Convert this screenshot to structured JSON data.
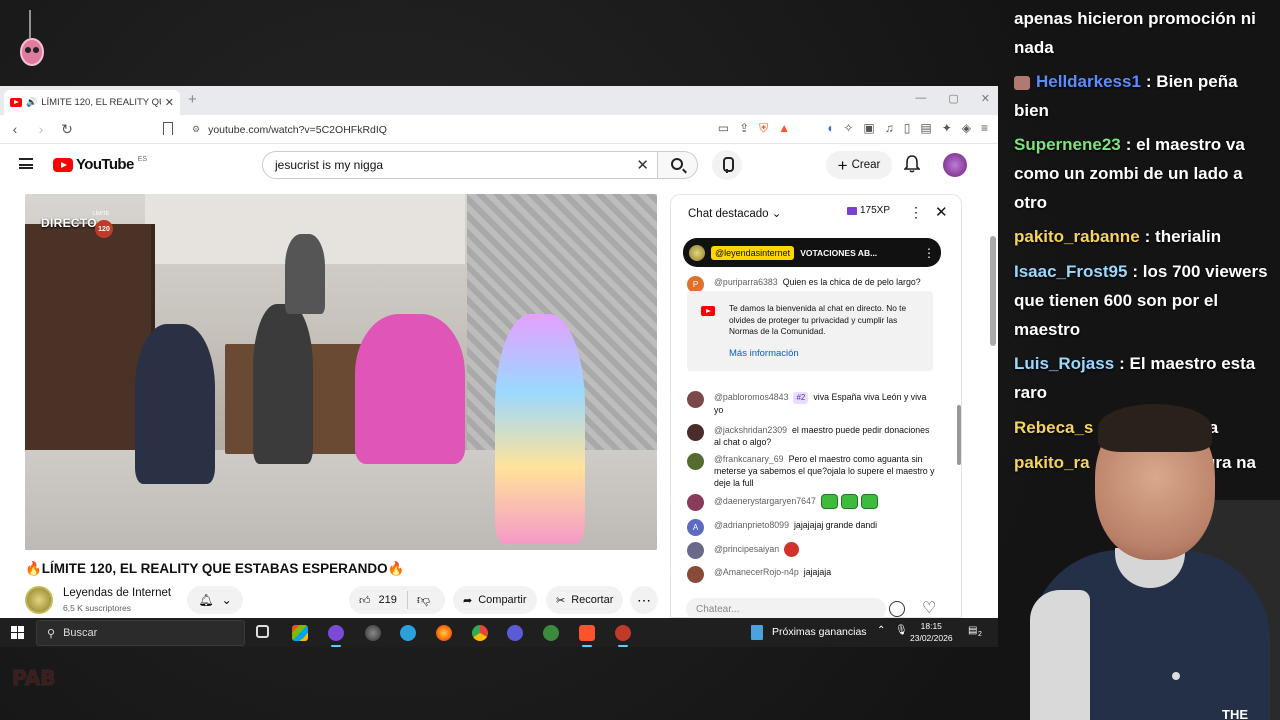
{
  "browser": {
    "tab_title": "LÍMITE 120, EL REALITY QU",
    "new_tab_symbol": "+",
    "window_controls": [
      "—",
      "▢",
      "✕"
    ],
    "url": "youtube.com/watch?v=5C2OHFkRdIQ"
  },
  "youtube": {
    "logo_word": "YouTube",
    "logo_region": "ES",
    "search_value": "jesucrist is my nigga",
    "create_label": "Crear",
    "video": {
      "live_label": "DIRECTO",
      "limite_label": "LÍMITE",
      "limite_number": "120",
      "title": "🔥LÍMITE 120, EL REALITY QUE ESTABAS ESPERANDO🔥",
      "channel_name": "Leyendas de Internet",
      "subscribers": "6,5 K suscriptores",
      "likes": "219",
      "share_label": "Compartir",
      "clip_label": "Recortar"
    },
    "chat": {
      "header": "Chat destacado",
      "xp": "175XP",
      "pinned_user": "@leyendasinternet",
      "pinned_text": "VOTACIONES AB...",
      "welcome_text": "Te damos la bienvenida al chat en directo. No te olvides de proteger tu privacidad y cumplir las Normas de la Comunidad.",
      "welcome_link": "Más información",
      "input_placeholder": "Chatear...",
      "messages": [
        {
          "user": "@puriparra6383",
          "text": "Quien es la chica de de pelo largo?",
          "initial": "P",
          "color": "#e0702b"
        },
        {
          "user": "@pabloromos4843",
          "badge": "#2",
          "text": "viva España viva León y viva yo",
          "initial": "",
          "color": "#7a4a4a"
        },
        {
          "user": "@jackshridan2309",
          "text": "el maestro puede pedir donaciones al chat o algo?",
          "initial": "",
          "color": "#4a2c2c"
        },
        {
          "user": "@frankcanary_69",
          "text": "Pero el maestro como aguanta sin meterse ya sabemos el que?ojala lo supere el maestro y deje la full",
          "initial": "",
          "color": "#556b2f"
        },
        {
          "user": "@daenerystargaryen7647",
          "text": "",
          "initial": "",
          "color": "#8a3a5a"
        },
        {
          "user": "@adrianprieto8099",
          "text": "jajajajaj grande dandi",
          "initial": "A",
          "color": "#5c6bc0"
        },
        {
          "user": "@principesaiyan",
          "text": "",
          "initial": "",
          "color": "#6a6a8a"
        },
        {
          "user": "@AmanecerRojo-n4p",
          "text": "jajajaja",
          "initial": "",
          "color": "#8a4a3a"
        }
      ]
    }
  },
  "taskbar": {
    "search_label": "Buscar",
    "tray_label": "Próximas ganancias",
    "time": "18:15",
    "date": "23/02/2026",
    "notification_count": "2"
  },
  "stream_chat": [
    {
      "name": "",
      "text": "apenas hicieron promoción ni nada",
      "color": "#ffffff"
    },
    {
      "name": "Helldarkess1",
      "text": ": Bien peña bien",
      "color": "#5b8cff"
    },
    {
      "name": "Supernene23",
      "text": ": el maestro va como un zombi de un lado a otro",
      "color": "#7ee07e"
    },
    {
      "name": "pakito_rabanne",
      "text": ": therialin",
      "color": "#f4d35e"
    },
    {
      "name": "Isaac_Frost95",
      "text": ": los 700 viewers que tienen 600 son por el maestro",
      "color": "#9ad8ff"
    },
    {
      "name": "Luis_Rojass",
      "text": ": El maestro esta raro",
      "color": "#9ad8ff"
    },
    {
      "name": "Rebeca_s",
      "text": "na",
      "color": "#f4d35e"
    },
    {
      "name": "pakito_ra",
      "text": "dura na",
      "color": "#f4d35e"
    }
  ],
  "webcam": {
    "shirt_text": "THE"
  }
}
